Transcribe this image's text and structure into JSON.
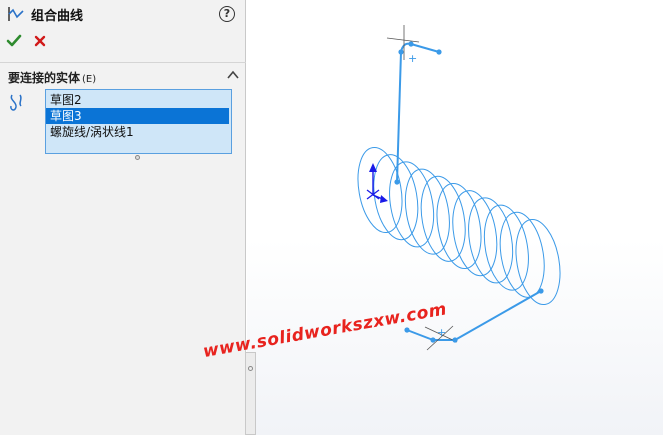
{
  "panel": {
    "title": "组合曲线",
    "help_label": "?",
    "group": {
      "title": "要连接的实体",
      "shortcut": "(E)"
    },
    "entities": [
      {
        "label": "草图2",
        "selected": false
      },
      {
        "label": "草图3",
        "selected": true
      },
      {
        "label": "螺旋线/涡状线1",
        "selected": false
      }
    ]
  },
  "colors": {
    "accent": "#0b74d6",
    "list_bg": "#cfe6f8",
    "curve": "#3b9ae8",
    "ok": "#2e8b2e",
    "cancel": "#d11a1a"
  },
  "watermark": "www.solidworkszxw.com"
}
